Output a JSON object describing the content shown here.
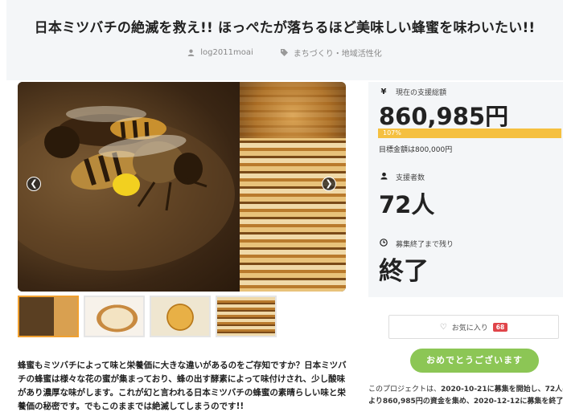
{
  "header": {
    "title": "日本ミツバチの絶滅を救え!! ほっぺたが落ちるほど美味しい蜂蜜を味わいたい!!",
    "author": "log2011moai",
    "category": "まちづくり・地域活性化"
  },
  "gallery": {
    "prev_icon": "chevron-left-icon",
    "next_icon": "chevron-right-icon",
    "thumbnails": [
      "bees-on-honeycomb",
      "cheesecake",
      "round-cake",
      "honeycomb"
    ]
  },
  "description": "蜂蜜もミツバチによって味と栄養価に大きな違いがあるのをご存知ですか？日本ミツバチの蜂蜜は様々な花の蜜が集まっており、蜂の出す酵素によって味付けされ、少し酸味があり濃厚な味がします。これが幻と言われる日本ミツバチの蜂蜜の素晴らしい味と栄養価の秘密です。でもこのままでは絶滅してしまうのです!!",
  "stats": {
    "total_label": "現在の支援総額",
    "total_value": "860,985円",
    "progress_text": "107%",
    "progress_ratio": 1.07,
    "goal_text": "目標金額は800,000円",
    "supporters_label": "支援者数",
    "supporters_value": "72人",
    "remaining_label": "募集終了まで残り",
    "remaining_value": "終了"
  },
  "favorite": {
    "label": "お気に入り",
    "count": "68"
  },
  "congrats_button": "おめでとうございます",
  "summary": {
    "line1_pre": "このプロジェクトは、",
    "line1_date": "2020-10-21に募集を開始し、72人の支",
    "line2_amount": "より860,985円の資金を集め、",
    "line2_date": "2020-12-12に募集を終了しまし"
  },
  "colors": {
    "accent": "#f5c040",
    "congrats": "#8cc655",
    "badge": "#e0454a"
  }
}
